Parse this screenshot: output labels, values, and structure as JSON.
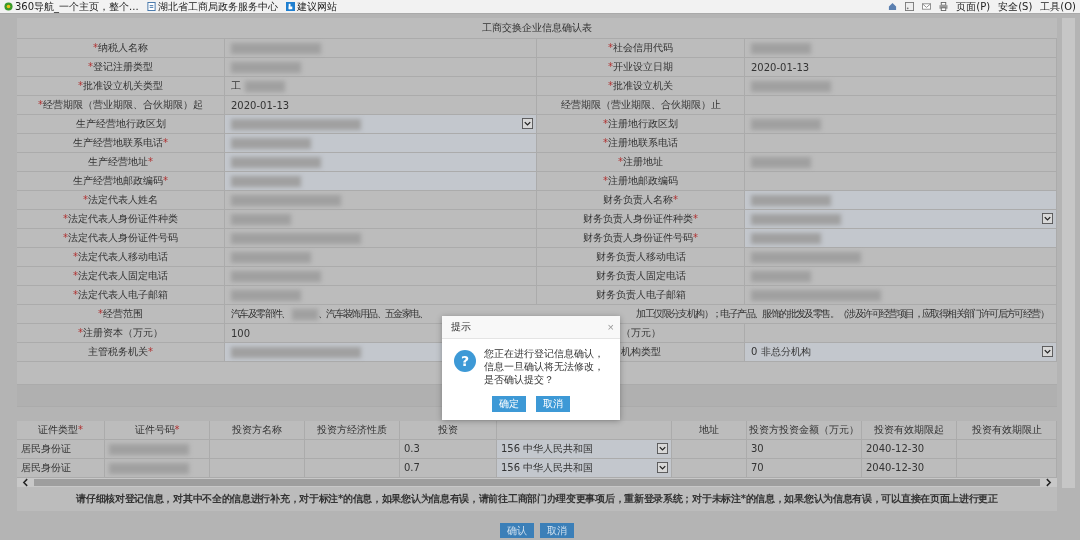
{
  "browser_bar": {
    "favorites": [
      {
        "label": "360导航_一个主页，整个...",
        "kind": "circle"
      },
      {
        "label": "湖北省工商局政务服务中心",
        "kind": "page"
      },
      {
        "label": "建议网站",
        "kind": "square"
      }
    ],
    "menus": [
      {
        "label": "页面(P)"
      },
      {
        "label": "安全(S)"
      },
      {
        "label": "工具(O)"
      }
    ]
  },
  "form": {
    "title": "工商交换企业信息确认表",
    "rows": [
      {
        "left": {
          "label": "纳税人名称",
          "mark_before": "*",
          "kind": "redacted"
        },
        "right": {
          "label": "社会信用代码",
          "mark_before": "*",
          "kind": "redacted"
        }
      },
      {
        "left": {
          "label": "登记注册类型",
          "mark_before": "*",
          "kind": "redacted"
        },
        "right": {
          "label": "开业设立日期",
          "mark_before": "*",
          "kind": "text",
          "value": "2020-01-13"
        }
      },
      {
        "left": {
          "label": "批准设立机关类型",
          "mark_before": "*",
          "kind": "partial",
          "value": "工"
        },
        "right": {
          "label": "批准设立机关",
          "mark_before": "*",
          "kind": "redacted"
        }
      },
      {
        "left": {
          "label": "经营期限（营业期限、合伙期限）起",
          "mark_before": "*",
          "kind": "text",
          "value": "2020-01-13"
        },
        "right": {
          "label": "经营期限（营业期限、合伙期限）止",
          "kind": "empty"
        }
      },
      {
        "left": {
          "label": "生产经营地行政区划",
          "kind": "redacted",
          "editable": true,
          "dropdown": true
        },
        "right": {
          "label": "注册地行政区划",
          "mark_before": "*",
          "kind": "redacted"
        }
      },
      {
        "left": {
          "label": "生产经营地联系电话",
          "mark_after": "*",
          "kind": "redacted",
          "editable": true
        },
        "right": {
          "label": "注册地联系电话",
          "mark_before": "*",
          "kind": "empty"
        }
      },
      {
        "left": {
          "label": "生产经营地址",
          "mark_after": "*",
          "kind": "redacted",
          "editable": true
        },
        "right": {
          "label": "注册地址",
          "mark_before": "*",
          "kind": "redacted"
        }
      },
      {
        "left": {
          "label": "生产经营地邮政编码",
          "mark_after": "*",
          "kind": "redacted",
          "editable": true
        },
        "right": {
          "label": "注册地邮政编码",
          "mark_before": "*",
          "kind": "empty"
        }
      },
      {
        "left": {
          "label": "法定代表人姓名",
          "mark_before": "*",
          "kind": "redacted"
        },
        "right": {
          "label": "财务负责人名称",
          "mark_after": "*",
          "kind": "redacted",
          "editable": true
        }
      },
      {
        "left": {
          "label": "法定代表人身份证件种类",
          "mark_before": "*",
          "kind": "redacted"
        },
        "right": {
          "label": "财务负责人身份证件种类",
          "mark_after": "*",
          "kind": "redacted",
          "editable": true,
          "dropdown": true
        }
      },
      {
        "left": {
          "label": "法定代表人身份证件号码",
          "mark_before": "*",
          "kind": "redacted"
        },
        "right": {
          "label": "财务负责人身份证件号码",
          "mark_after": "*",
          "kind": "redacted",
          "editable": true
        }
      },
      {
        "left": {
          "label": "法定代表人移动电话",
          "mark_before": "*",
          "kind": "redacted"
        },
        "right": {
          "label": "财务负责人移动电话",
          "kind": "redacted"
        }
      },
      {
        "left": {
          "label": "法定代表人固定电话",
          "mark_before": "*",
          "kind": "redacted"
        },
        "right": {
          "label": "财务负责人固定电话",
          "kind": "redacted"
        }
      },
      {
        "left": {
          "label": "法定代表人电子邮箱",
          "mark_before": "*",
          "kind": "redacted"
        },
        "right": {
          "label": "财务负责人电子邮箱",
          "kind": "redacted"
        }
      },
      {
        "wide": {
          "label": "经营范围",
          "mark_before": "*",
          "value_parts": [
            "汽车及零部件、",
            "、汽车装饰用品、五金家电、",
            "加工仅限分支机构）；电子产品、服饰的批发及零售。（涉及许可经营项目，应取得相关部门许可后方可经营）"
          ]
        }
      },
      {
        "left": {
          "label": "注册资本（万元）",
          "mark_before": "*",
          "kind": "text",
          "value": "100"
        },
        "right": {
          "label": "（万元）",
          "kind": "empty"
        }
      },
      {
        "left": {
          "label": "主管税务机关",
          "mark_after": "*",
          "kind": "redacted",
          "editable": true
        },
        "right": {
          "label": "机构类型",
          "kind": "text",
          "value": "0 非总分机构",
          "editable": true,
          "dropdown": true
        }
      }
    ]
  },
  "investors": {
    "columns": [
      {
        "label": "证件类型",
        "mark": "*"
      },
      {
        "label": "证件号码",
        "mark": "*"
      },
      {
        "label": "投资方名称"
      },
      {
        "label": "投资方经济性质"
      },
      {
        "label": "投资"
      },
      {},
      {
        "label": "地址"
      },
      {
        "label": "投资方投资金额（万元）"
      },
      {
        "label": "投资有效期限起"
      },
      {
        "label": "投资有效期限止"
      }
    ],
    "rows": [
      [
        {
          "kind": "text",
          "value": "居民身份证"
        },
        {
          "kind": "redacted"
        },
        {
          "kind": "empty"
        },
        {
          "kind": "empty"
        },
        {
          "kind": "text",
          "value": "0.3"
        },
        {
          "kind": "select",
          "value": "156 中华人民共和国"
        },
        {
          "kind": "empty"
        },
        {
          "kind": "text",
          "value": "30"
        },
        {
          "kind": "text",
          "value": "2040-12-30"
        },
        {
          "kind": "empty"
        }
      ],
      [
        {
          "kind": "text",
          "value": "居民身份证"
        },
        {
          "kind": "redacted"
        },
        {
          "kind": "empty"
        },
        {
          "kind": "empty"
        },
        {
          "kind": "text",
          "value": "0.7"
        },
        {
          "kind": "select",
          "value": "156 中华人民共和国"
        },
        {
          "kind": "empty"
        },
        {
          "kind": "text",
          "value": "70"
        },
        {
          "kind": "text",
          "value": "2040-12-30"
        },
        {
          "kind": "empty"
        }
      ]
    ]
  },
  "notice": "请仔细核对登记信息，对其中不全的信息进行补充，对于标注*的信息，如果您认为信息有误，请前往工商部门办理变更事项后，重新登录系统；对于未标注*的信息，如果您认为信息有误，可以直接在页面上进行更正",
  "buttons": [
    "确认",
    "取消"
  ],
  "dialog": {
    "title": "提示",
    "close": "×",
    "icon": "?",
    "message": "您正在进行登记信息确认，信息一旦确认将无法修改，是否确认提交？",
    "buttons": [
      "确定",
      "取消"
    ]
  }
}
